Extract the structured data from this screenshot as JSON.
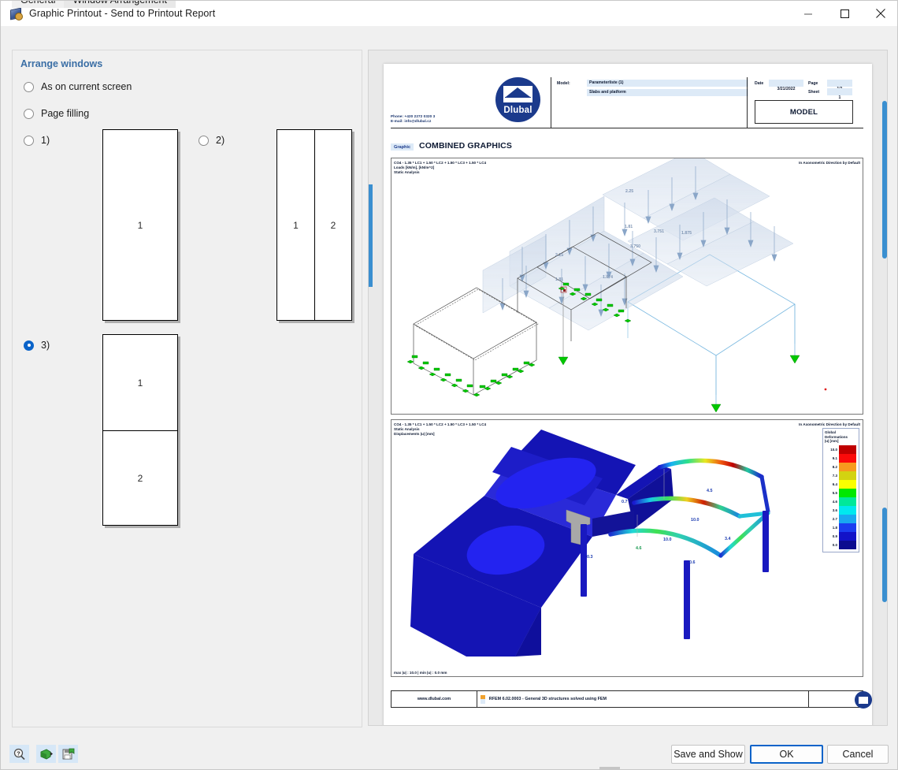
{
  "window": {
    "title": "Graphic Printout - Send to Printout Report",
    "icon": "graphic-printout-icon",
    "controls": {
      "minimize": "—",
      "maximize": "□",
      "close": "✕"
    }
  },
  "tabs": [
    {
      "label": "General",
      "active": false
    },
    {
      "label": "Window Arrangement",
      "active": true
    }
  ],
  "left_panel": {
    "group_title": "Arrange windows",
    "options": [
      {
        "label": "As on current screen",
        "selected": false
      },
      {
        "label": "Page filling",
        "selected": false
      },
      {
        "label": "1)",
        "selected": false
      },
      {
        "label": "2)",
        "selected": false
      },
      {
        "label": "3)",
        "selected": true
      }
    ],
    "layout_previews": {
      "one": {
        "cells": [
          "1"
        ]
      },
      "two": {
        "cells": [
          "1",
          "2"
        ]
      },
      "three": {
        "cells": [
          "1",
          "2"
        ]
      }
    }
  },
  "preview": {
    "header": {
      "phone": "Phone: +420 2272 0320 3",
      "email": "E-mail: info@dlubal.cz",
      "logo_text": "Dlubal",
      "model_label": "Model:",
      "model_name": "Parameterliste (1)",
      "model_desc": "Slabs and platform",
      "date_label": "Date",
      "date_value": "3/21/2022",
      "page_label": "Page",
      "page_value": "1/1",
      "sheet_label": "Sheet",
      "sheet_value": "1",
      "model_box": "MODEL"
    },
    "section": {
      "tag": "Graphic",
      "title": "COMBINED GRAPHICS"
    },
    "graphic1": {
      "line1": "CO4 - 1.35 * LC1 + 1.50 * LC2 + 1.50 * LC3 + 1.50 * LC4",
      "line2": "Loads [kN/m], [kN/m^2]",
      "line3": "Static Analysis",
      "right_note": "In Axonometric Direction by Default",
      "load_labels": [
        "2.25",
        "1.81",
        "3.751",
        "1.875",
        "3.750",
        "2.25",
        "1.81",
        "1.874"
      ]
    },
    "graphic2": {
      "line1": "CO4 - 1.35 * LC1 + 1.50 * LC2 + 1.50 * LC3 + 1.50 * LC4",
      "line2": "Static Analysis",
      "line3": "Displacements |u| [mm]",
      "right_note": "In Axonometric Direction by Default",
      "footer_note": "max |u| : 10.0 | min |u| : 0.0 mm",
      "value_labels": [
        "0.7",
        "0.3",
        "4.5",
        "10.0",
        "10.0",
        "4.6",
        "3.4",
        "0.6"
      ],
      "legend": {
        "title_line1": "Global",
        "title_line2": "Deformations",
        "title_line3": "|u| [mm]",
        "entries": [
          {
            "value": "10.0",
            "color": "#c00000"
          },
          {
            "value": "9.1",
            "color": "#fb0a0a"
          },
          {
            "value": "8.2",
            "color": "#f79a1e"
          },
          {
            "value": "7.3",
            "color": "#d3d311"
          },
          {
            "value": "6.4",
            "color": "#faff00"
          },
          {
            "value": "5.5",
            "color": "#00e800"
          },
          {
            "value": "4.6",
            "color": "#00e89a"
          },
          {
            "value": "3.6",
            "color": "#00e8ef"
          },
          {
            "value": "2.7",
            "color": "#19a8f0"
          },
          {
            "value": "1.8",
            "color": "#1a3df0"
          },
          {
            "value": "0.9",
            "color": "#1212c8"
          },
          {
            "value": "0.0",
            "color": "#0b0b8f"
          }
        ]
      }
    },
    "footer": {
      "url": "www.dlubal.com",
      "program": "RFEM 6.02.0003 - General 3D structures solved using FEM"
    }
  },
  "bottom_bar": {
    "tools": [
      {
        "name": "help-magnifier-icon"
      },
      {
        "name": "apply-green-icon"
      },
      {
        "name": "save-settings-icon"
      }
    ],
    "buttons": [
      {
        "label": "Save and Show",
        "primary": false
      },
      {
        "label": "OK",
        "primary": true
      },
      {
        "label": "Cancel",
        "primary": false
      }
    ]
  },
  "colors": {
    "accent": "#0a63c9",
    "group_title": "#3a6ea5",
    "brand_blue": "#1b3a8c",
    "field_fill": "#ddeaf7"
  }
}
